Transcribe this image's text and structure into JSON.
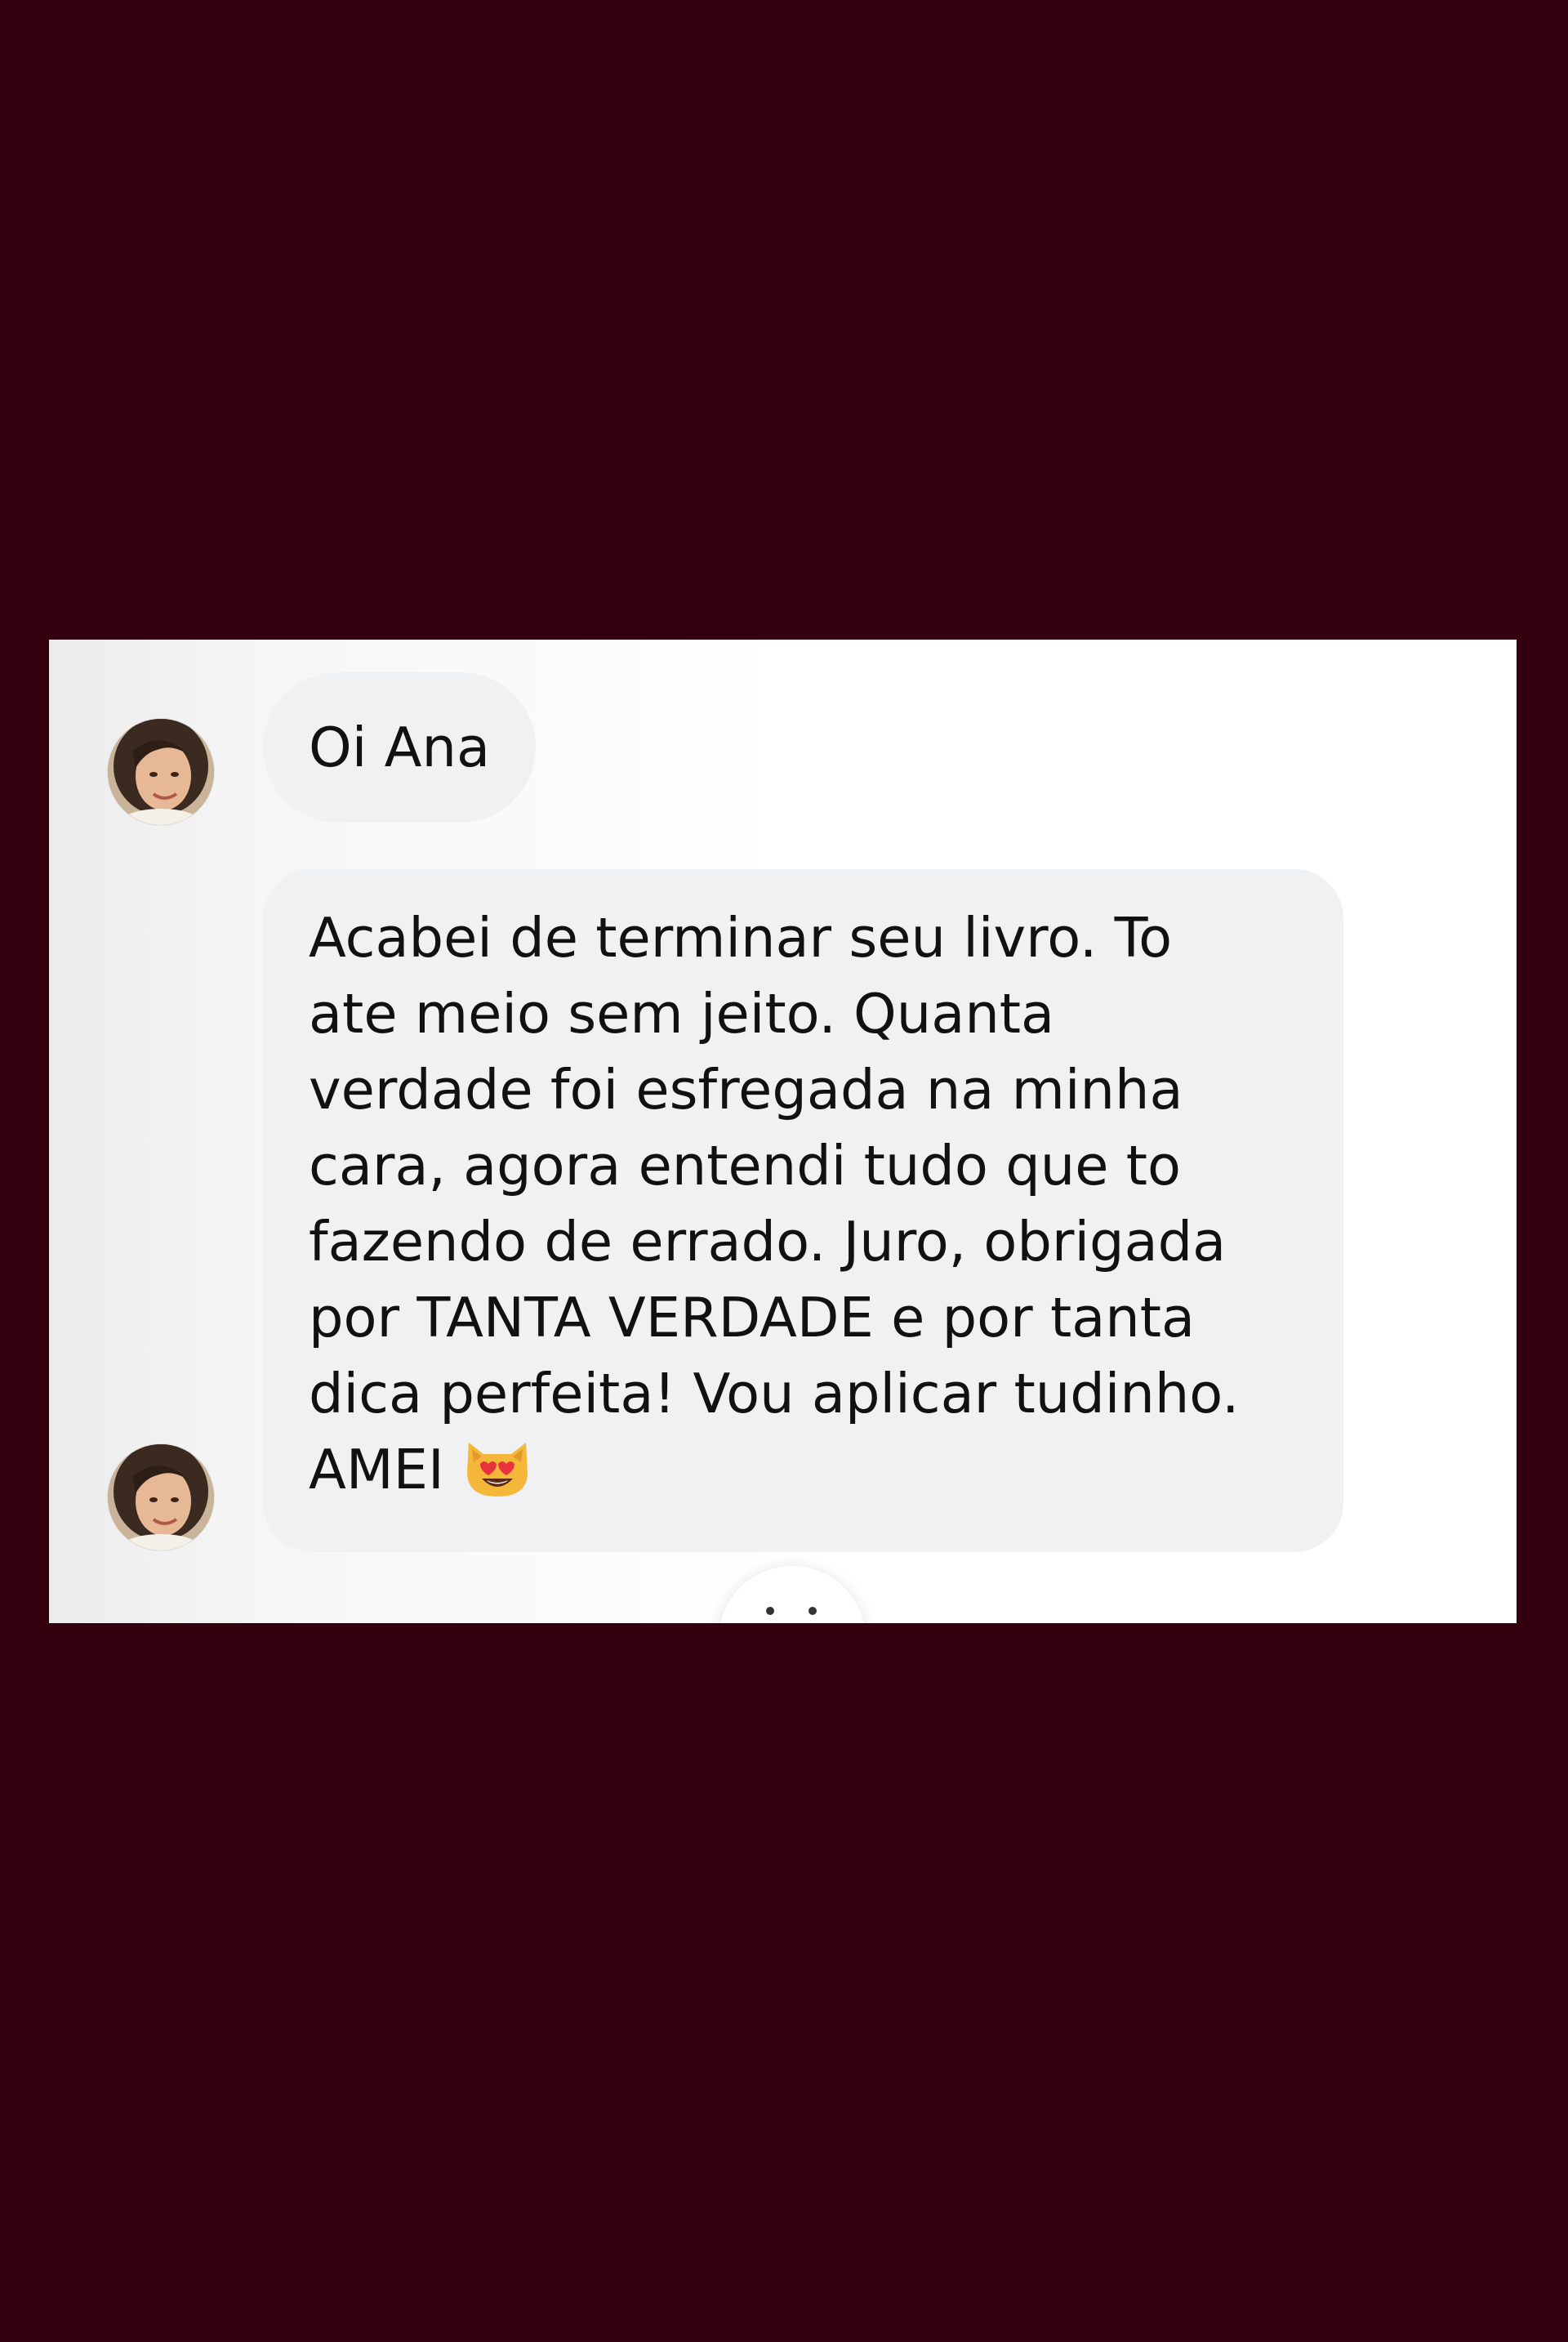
{
  "conversation": {
    "messages": [
      {
        "text": "Oi Ana"
      },
      {
        "text": "Acabei de terminar seu livro. To\nate meio sem jeito. Quanta\nverdade foi esfregada na minha\ncara, agora entendi tudo que to\nfazendo de errado. Juro, obrigada\npor TANTA VERDADE e por tanta\ndica perfeita! Vou aplicar tudinho.\nAMEI",
        "emoji": "smiling-cat-heart-eyes-emoji"
      }
    ]
  },
  "colors": {
    "background": "#34000f",
    "card": "#ffffff",
    "bubble": "#f0f1f3",
    "text": "#111111"
  }
}
